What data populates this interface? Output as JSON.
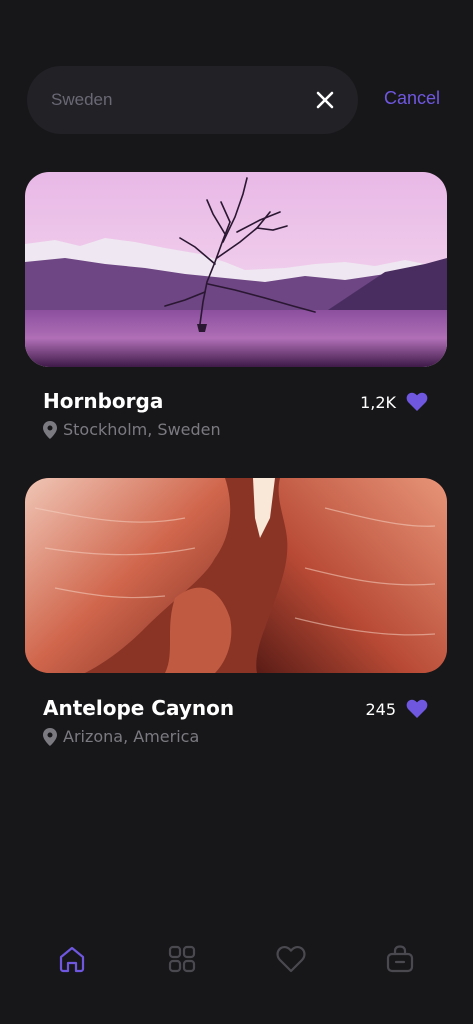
{
  "search": {
    "query": "Sweden",
    "cancel_label": "Cancel"
  },
  "cards": [
    {
      "title": "Hornborga",
      "location": "Stockholm, Sweden",
      "likes": "1,2K"
    },
    {
      "title": "Antelope Caynon",
      "location": "Arizona, America",
      "likes": "245"
    }
  ],
  "icons": {
    "clear": "close-icon",
    "location": "location-pin-icon",
    "like": "heart-icon",
    "nav": [
      "home-icon",
      "grid-icon",
      "heart-outline-icon",
      "shopping-bag-icon"
    ]
  },
  "colors": {
    "background": "#171719",
    "accent": "#6f57e0",
    "search_bg": "#222126",
    "muted_text": "#7b7a80"
  }
}
